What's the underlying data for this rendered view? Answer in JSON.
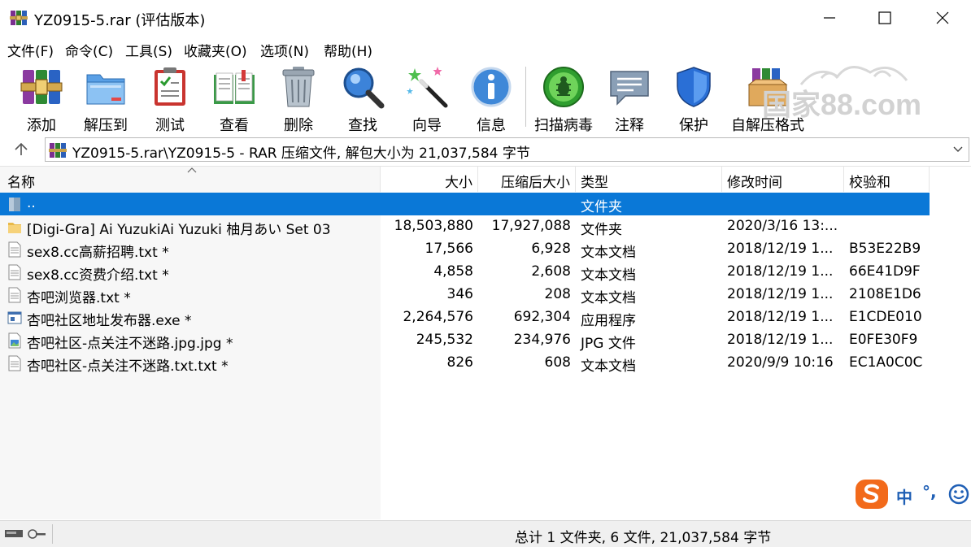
{
  "window": {
    "title": "YZ0915-5.rar (评估版本)"
  },
  "menu": [
    "文件(F)",
    "命令(C)",
    "工具(S)",
    "收藏夹(O)",
    "选项(N)",
    "帮助(H)"
  ],
  "toolbar": [
    {
      "label": "添加",
      "icon": "add-archive-icon"
    },
    {
      "label": "解压到",
      "icon": "extract-folder-icon"
    },
    {
      "label": "测试",
      "icon": "test-clipboard-icon"
    },
    {
      "label": "查看",
      "icon": "view-book-icon"
    },
    {
      "label": "删除",
      "icon": "trash-can-icon"
    },
    {
      "label": "查找",
      "icon": "magnifier-icon"
    },
    {
      "label": "向导",
      "icon": "magic-wand-icon"
    },
    {
      "label": "信息",
      "icon": "info-icon"
    },
    {
      "label": "扫描病毒",
      "icon": "virus-scan-icon"
    },
    {
      "label": "注释",
      "icon": "comment-bubble-icon"
    },
    {
      "label": "保护",
      "icon": "shield-icon"
    },
    {
      "label": "自解压格式",
      "icon": "sfx-box-icon"
    }
  ],
  "watermark": {
    "text": "国家88.com"
  },
  "address": {
    "path": "YZ0915-5.rar\\YZ0915-5 - RAR 压缩文件, 解包大小为 21,037,584 字节"
  },
  "columns": {
    "name": "名称",
    "size": "大小",
    "packed": "压缩后大小",
    "type": "类型",
    "modified": "修改时间",
    "crc": "校验和"
  },
  "files": [
    {
      "icon": "parent-folder-icon",
      "name": "..",
      "size": "",
      "packed": "",
      "type": "文件夹",
      "modified": "",
      "crc": "",
      "selected": true
    },
    {
      "icon": "folder-icon",
      "name": "[Digi-Gra] Ai YuzukiAi Yuzuki 柚月あい Set 03",
      "size": "18,503,880",
      "packed": "17,927,088",
      "type": "文件夹",
      "modified": "2020/3/16 13:...",
      "crc": ""
    },
    {
      "icon": "text-file-icon",
      "name": "sex8.cc高薪招聘.txt *",
      "size": "17,566",
      "packed": "6,928",
      "type": "文本文档",
      "modified": "2018/12/19 1...",
      "crc": "B53E22B9"
    },
    {
      "icon": "text-file-icon",
      "name": "sex8.cc资费介绍.txt *",
      "size": "4,858",
      "packed": "2,608",
      "type": "文本文档",
      "modified": "2018/12/19 1...",
      "crc": "66E41D9F"
    },
    {
      "icon": "text-file-icon",
      "name": "杏吧浏览器.txt *",
      "size": "346",
      "packed": "208",
      "type": "文本文档",
      "modified": "2018/12/19 1...",
      "crc": "2108E1D6"
    },
    {
      "icon": "exe-file-icon",
      "name": "杏吧社区地址发布器.exe *",
      "size": "2,264,576",
      "packed": "692,304",
      "type": "应用程序",
      "modified": "2018/12/19 1...",
      "crc": "E1CDE010"
    },
    {
      "icon": "image-file-icon",
      "name": "杏吧社区-点关注不迷路.jpg.jpg *",
      "size": "245,532",
      "packed": "234,976",
      "type": "JPG 文件",
      "modified": "2018/12/19 1...",
      "crc": "E0FE30F9"
    },
    {
      "icon": "text-file-icon",
      "name": "杏吧社区-点关注不迷路.txt.txt *",
      "size": "826",
      "packed": "608",
      "type": "文本文档",
      "modified": "2020/9/9 10:16",
      "crc": "EC1A0C0C"
    }
  ],
  "status": {
    "text": "总计 1 文件夹, 6 文件, 21,037,584 字节"
  },
  "ime": {
    "mode": "中",
    "punct": "°,"
  }
}
